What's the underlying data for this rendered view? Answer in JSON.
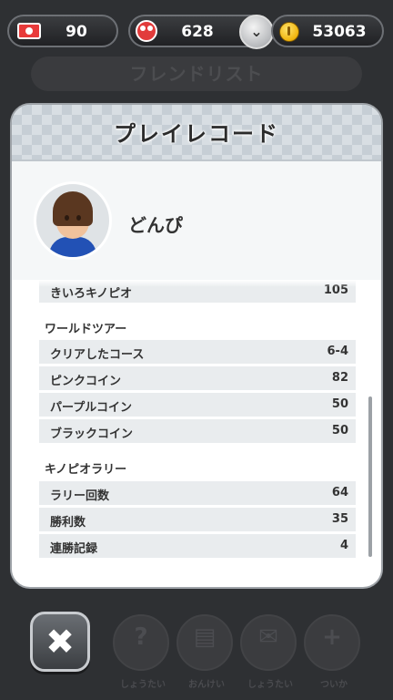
{
  "status_bar": {
    "tickets": "90",
    "toads": "628",
    "coins": "53063",
    "ticket_icon": "rally-ticket-icon",
    "toad_icon": "toad-icon",
    "coin_icon": "coin-icon",
    "expand_icon": "chevron-down-icon"
  },
  "background": {
    "title": "フレンドリスト",
    "dock_buttons": [
      "しょうたい",
      "おんけい",
      "しょうたい",
      "ついか"
    ]
  },
  "panel": {
    "title": "プレイレコード",
    "player_name": "どんぴ",
    "partial_row": {
      "label": "きいろキノピオ",
      "value": "105"
    },
    "sections": [
      {
        "title": "ワールドツアー",
        "rows": [
          {
            "label": "クリアしたコース",
            "value": "6-4"
          },
          {
            "label": "ピンクコイン",
            "value": "82"
          },
          {
            "label": "パープルコイン",
            "value": "50"
          },
          {
            "label": "ブラックコイン",
            "value": "50"
          }
        ]
      },
      {
        "title": "キノピオラリー",
        "rows": [
          {
            "label": "ラリー回数",
            "value": "64"
          },
          {
            "label": "勝利数",
            "value": "35"
          },
          {
            "label": "連勝記録",
            "value": "4"
          }
        ]
      }
    ]
  },
  "close_button": {
    "icon": "close-icon",
    "glyph": "✖"
  },
  "colors": {
    "background": "#2e3033",
    "panel": "#ffffff",
    "row": "#e9ecee",
    "pill_border": "#6d7075"
  }
}
